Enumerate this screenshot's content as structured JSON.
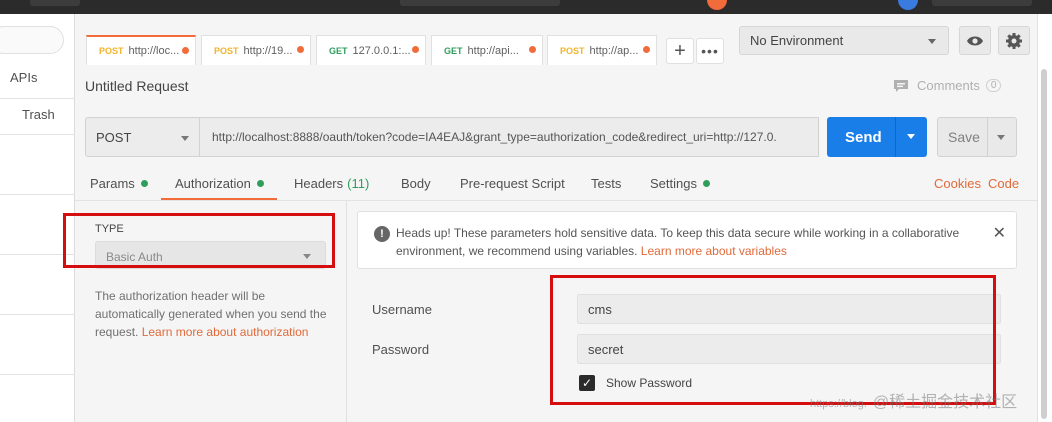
{
  "sidebar": {
    "items": [
      {
        "label": "APIs"
      },
      {
        "label": "Trash"
      }
    ]
  },
  "tabs": [
    {
      "method": "POST",
      "label": "http://loc...",
      "active": true
    },
    {
      "method": "POST",
      "label": "http://19..."
    },
    {
      "method": "GET",
      "label": "127.0.0.1:..."
    },
    {
      "method": "GET",
      "label": "http://api..."
    },
    {
      "method": "POST",
      "label": "http://ap..."
    }
  ],
  "environment": {
    "selected": "No Environment"
  },
  "request": {
    "title": "Untitled Request",
    "comments_label": "Comments",
    "comments_count": "0",
    "method": "POST",
    "url": "http://localhost:8888/oauth/token?code=IA4EAJ&grant_type=authorization_code&redirect_uri=http://127.0.",
    "send_label": "Send",
    "save_label": "Save"
  },
  "subtabs": {
    "params": "Params",
    "authorization": "Authorization",
    "headers": "Headers",
    "headers_count": "(11)",
    "body": "Body",
    "prerequest": "Pre-request Script",
    "tests": "Tests",
    "settings": "Settings",
    "cookies": "Cookies",
    "code": "Code"
  },
  "auth": {
    "type_label": "TYPE",
    "type_value": "Basic Auth",
    "description": "The authorization header will be automatically generated when you send the request.",
    "learn_more": "Learn more about authorization"
  },
  "notice": {
    "text": "Heads up! These parameters hold sensitive data. To keep this data secure while working in a collaborative environment, we recommend using variables.",
    "link": "Learn more about variables"
  },
  "form": {
    "username_label": "Username",
    "username_value": "cms",
    "password_label": "Password",
    "password_value": "secret",
    "show_password_label": "Show Password"
  },
  "watermark": {
    "url_text": "https://blog.",
    "text": "@稀土掘金技术社区"
  },
  "colors": {
    "accent": "#f26b3a",
    "send": "#1a7ee8",
    "post": "#f0b429",
    "get": "#2f9e5c",
    "annotation": "#d40e0e"
  }
}
